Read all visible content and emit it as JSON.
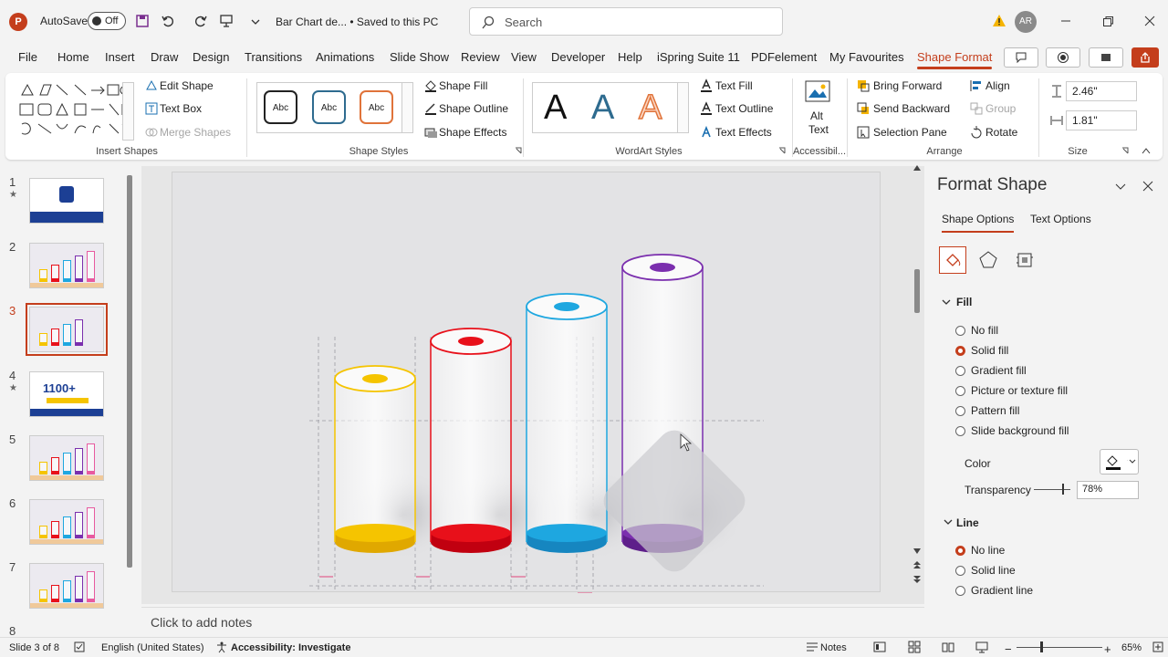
{
  "titlebar": {
    "app_logo": "P",
    "autosave_label": "AutoSave",
    "autosave_state": "Off",
    "doc_title": "Bar Chart de...  •  Saved to this PC",
    "search_placeholder": "Search",
    "avatar_initials": "AR"
  },
  "tabs": [
    "File",
    "Home",
    "Insert",
    "Draw",
    "Design",
    "Transitions",
    "Animations",
    "Slide Show",
    "Review",
    "View",
    "Developer",
    "Help",
    "iSpring Suite 11",
    "PDFelement",
    "My Favourites",
    "Shape Format"
  ],
  "active_tab": "Shape Format",
  "ribbon": {
    "insert_shapes": {
      "edit_shape": "Edit Shape",
      "text_box": "Text Box",
      "merge_shapes": "Merge Shapes",
      "label": "Insert Shapes"
    },
    "shape_styles": {
      "samples": [
        "Abc",
        "Abc",
        "Abc"
      ],
      "shape_fill": "Shape Fill",
      "shape_outline": "Shape Outline",
      "shape_effects": "Shape Effects",
      "label": "Shape Styles"
    },
    "wordart": {
      "samples": [
        "A",
        "A",
        "A"
      ],
      "text_fill": "Text Fill",
      "text_outline": "Text Outline",
      "text_effects": "Text Effects",
      "label": "WordArt Styles"
    },
    "accessibility": {
      "alt_text_1": "Alt",
      "alt_text_2": "Text",
      "label": "Accessibil..."
    },
    "arrange": {
      "bring_forward": "Bring Forward",
      "send_backward": "Send Backward",
      "selection_pane": "Selection Pane",
      "align": "Align",
      "group": "Group",
      "rotate": "Rotate",
      "label": "Arrange"
    },
    "size": {
      "height": "2.46\"",
      "width": "1.81\"",
      "label": "Size"
    }
  },
  "slides": [
    {
      "num": "1",
      "star": "★"
    },
    {
      "num": "2",
      "star": ""
    },
    {
      "num": "3",
      "star": ""
    },
    {
      "num": "4",
      "star": "★",
      "badge": "1100+"
    },
    {
      "num": "5",
      "star": ""
    },
    {
      "num": "6",
      "star": ""
    },
    {
      "num": "7",
      "star": ""
    },
    {
      "num": "8",
      "star": ""
    }
  ],
  "notes_placeholder": "Click to add notes",
  "cylinders": [
    {
      "color": "#f5c400",
      "dark": "#e0a800"
    },
    {
      "color": "#e8101a",
      "dark": "#c10010"
    },
    {
      "color": "#1ea7e0",
      "dark": "#1686c0"
    },
    {
      "color": "#7b2fae",
      "dark": "#5e1f8a"
    }
  ],
  "format_pane": {
    "title": "Format Shape",
    "tabs": [
      "Shape Options",
      "Text Options"
    ],
    "fill_section": "Fill",
    "fill_options": [
      "No fill",
      "Solid fill",
      "Gradient fill",
      "Picture or texture fill",
      "Pattern fill",
      "Slide background fill"
    ],
    "fill_selected": 1,
    "color_label": "Color",
    "transparency_label": "Transparency",
    "transparency_value": "78%",
    "transparency_level": 0.78,
    "line_section": "Line",
    "line_options": [
      "No line",
      "Solid line",
      "Gradient line"
    ],
    "line_selected": 0
  },
  "statusbar": {
    "slide_info": "Slide 3 of 8",
    "language": "English (United States)",
    "accessibility": "Accessibility: Investigate",
    "notes": "Notes",
    "zoom": "65%"
  },
  "colors": {
    "accent": "#c43e1c"
  }
}
